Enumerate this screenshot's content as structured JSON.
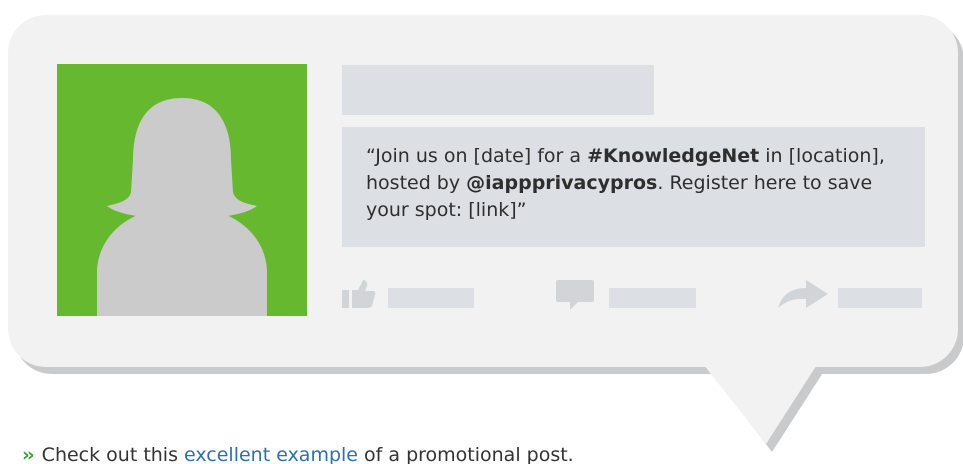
{
  "colors": {
    "avatar_bg": "#66b82f",
    "placeholder": "#dce0e4",
    "bubble": "#f2f2f2",
    "bubble_shadow": "#c9cacb",
    "icon": "#d2d5d8",
    "chevron": "#3ea33a",
    "link": "#2d6fb5"
  },
  "post": {
    "q1": "“Join us on [date] for a ",
    "hashtag": "#KnowledgeNet",
    "q2": " in [location], hosted by ",
    "handle": "@iappprivacypros",
    "q3": ". Register here to save your spot: [link]”"
  },
  "actions": {
    "like_icon": "thumbs-up-icon",
    "comment_icon": "comment-icon",
    "share_icon": "share-arrow-icon"
  },
  "footer": {
    "chevron": "››",
    "before_link": "Check out this ",
    "link_text": "excellent example",
    "after_link": " of a promotional post."
  }
}
